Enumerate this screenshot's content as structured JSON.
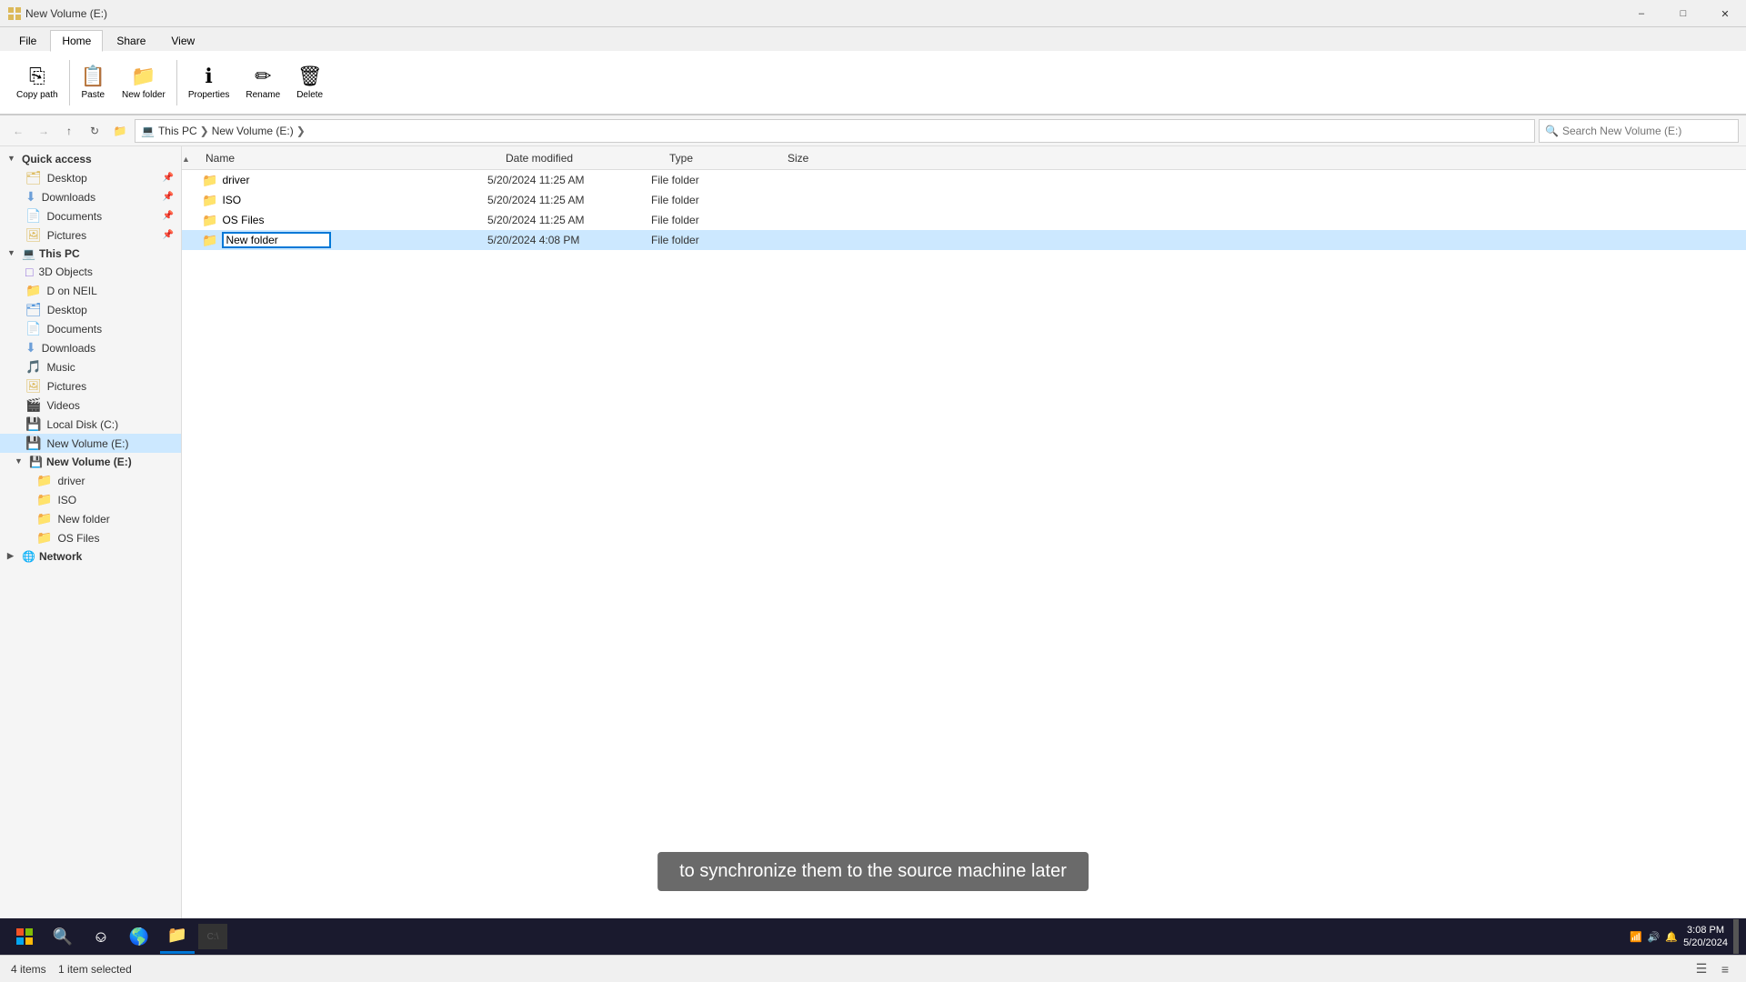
{
  "window": {
    "title": "New Volume (E:)",
    "titlebar_text": "New Volume (E:)"
  },
  "ribbon": {
    "tabs": [
      "File",
      "Home",
      "Share",
      "View"
    ],
    "active_tab": "Home"
  },
  "addressbar": {
    "breadcrumbs": [
      "This PC",
      "New Volume (E:)"
    ],
    "search_placeholder": "Search New Volume (E:)"
  },
  "columns": {
    "name": "Name",
    "date_modified": "Date modified",
    "type": "Type",
    "size": "Size"
  },
  "files": [
    {
      "name": "driver",
      "date": "5/20/2024 11:25 AM",
      "type": "File folder",
      "size": "",
      "selected": false,
      "renaming": false
    },
    {
      "name": "ISO",
      "date": "5/20/2024 11:25 AM",
      "type": "File folder",
      "size": "",
      "selected": false,
      "renaming": false
    },
    {
      "name": "OS Files",
      "date": "5/20/2024 11:25 AM",
      "type": "File folder",
      "size": "",
      "selected": false,
      "renaming": false
    },
    {
      "name": "New folder",
      "date": "5/20/2024 4:08 PM",
      "type": "File folder",
      "size": "",
      "selected": true,
      "renaming": true
    }
  ],
  "sidebar": {
    "quick_access_label": "Quick access",
    "quick_access_items": [
      {
        "label": "Desktop",
        "pin": true
      },
      {
        "label": "Downloads",
        "pin": true
      },
      {
        "label": "Documents",
        "pin": true
      },
      {
        "label": "Pictures",
        "pin": true
      }
    ],
    "this_pc_label": "This PC",
    "this_pc_items": [
      {
        "label": "3D Objects"
      },
      {
        "label": "D on NEIL"
      },
      {
        "label": "Desktop"
      },
      {
        "label": "Documents"
      },
      {
        "label": "Downloads"
      },
      {
        "label": "Music"
      },
      {
        "label": "Pictures"
      },
      {
        "label": "Videos"
      },
      {
        "label": "Local Disk (C:)"
      },
      {
        "label": "New Volume (E:)",
        "active": true
      }
    ],
    "new_volume_label": "New Volume (E:)",
    "new_volume_items": [
      {
        "label": "driver"
      },
      {
        "label": "ISO"
      },
      {
        "label": "New folder"
      },
      {
        "label": "OS Files"
      }
    ],
    "network_label": "Network"
  },
  "status": {
    "item_count": "4 items",
    "selected_count": "1 item selected"
  },
  "subtitle": {
    "text": "to synchronize them to the source machine later"
  },
  "taskbar": {
    "time": "3:08 PM",
    "date": "5/20/2024"
  }
}
